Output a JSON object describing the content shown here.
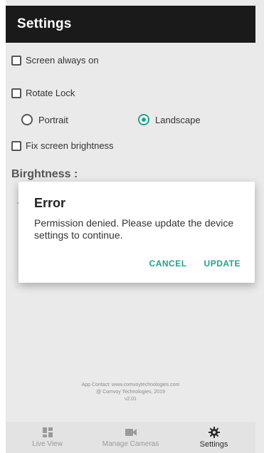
{
  "app_bar": {
    "title": "Settings"
  },
  "settings": {
    "screen_always_on": {
      "label": "Screen always on",
      "checked": false
    },
    "rotate_lock": {
      "label": "Rotate Lock",
      "checked": false
    },
    "orientation": {
      "portrait": {
        "label": "Portrait",
        "selected": false
      },
      "landscape": {
        "label": "Landscape",
        "selected": true
      }
    },
    "fix_brightness": {
      "label": "Fix screen brightness",
      "checked": false
    },
    "brightness_title": "Birghtness :"
  },
  "footer": {
    "line1": "App Contact: www.comvoytechnologies.com",
    "line2": "@ Comvoy Technologies, 2019",
    "line3": "v2.01"
  },
  "bottom_nav": {
    "items": [
      {
        "label": "Live View",
        "icon": "grid-icon",
        "active": false
      },
      {
        "label": "Manage Cameras",
        "icon": "camera-icon",
        "active": false
      },
      {
        "label": "Settings",
        "icon": "gear-icon",
        "active": true
      }
    ]
  },
  "dialog": {
    "title": "Error",
    "message": "Permission denied. Please update the device settings to continue.",
    "cancel_label": "CANCEL",
    "update_label": "UPDATE"
  },
  "colors": {
    "accent": "#1fa38a",
    "app_bar": "#1a1a1a",
    "background": "#eaeaea"
  }
}
